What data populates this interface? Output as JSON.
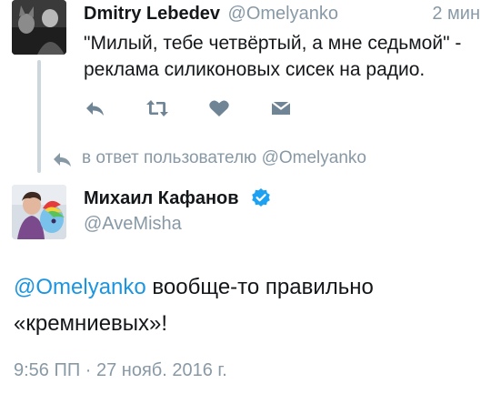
{
  "parent_tweet": {
    "author_name": "Dmitry Lebedev",
    "author_handle": "@Omelyanko",
    "time": "2 мин",
    "text": "\"Милый, тебе четвёртый, а мне седьмой\" - реклама силиконовых сисек на радио.",
    "actions": [
      "reply-icon",
      "retweet-icon",
      "like-icon",
      "message-icon"
    ]
  },
  "reply_context": {
    "text": "в ответ пользователю @Omelyanko",
    "icon": "reply-icon"
  },
  "main_tweet": {
    "author_name": "Михаил Кафанов",
    "author_handle": "@AveMisha",
    "verified": true,
    "mention": "@Omelyanko",
    "text": " вообще-то правильно «кремниевых»!",
    "timestamp": "9:56 ПП · 27 нояб. 2016 г."
  },
  "colors": {
    "text": "#14171a",
    "secondary": "#8899a6",
    "link": "#1b95e0",
    "verified_badge": "#1da1f2",
    "action_icon": "#6f8595",
    "thread_line": "#ccd6dd"
  }
}
